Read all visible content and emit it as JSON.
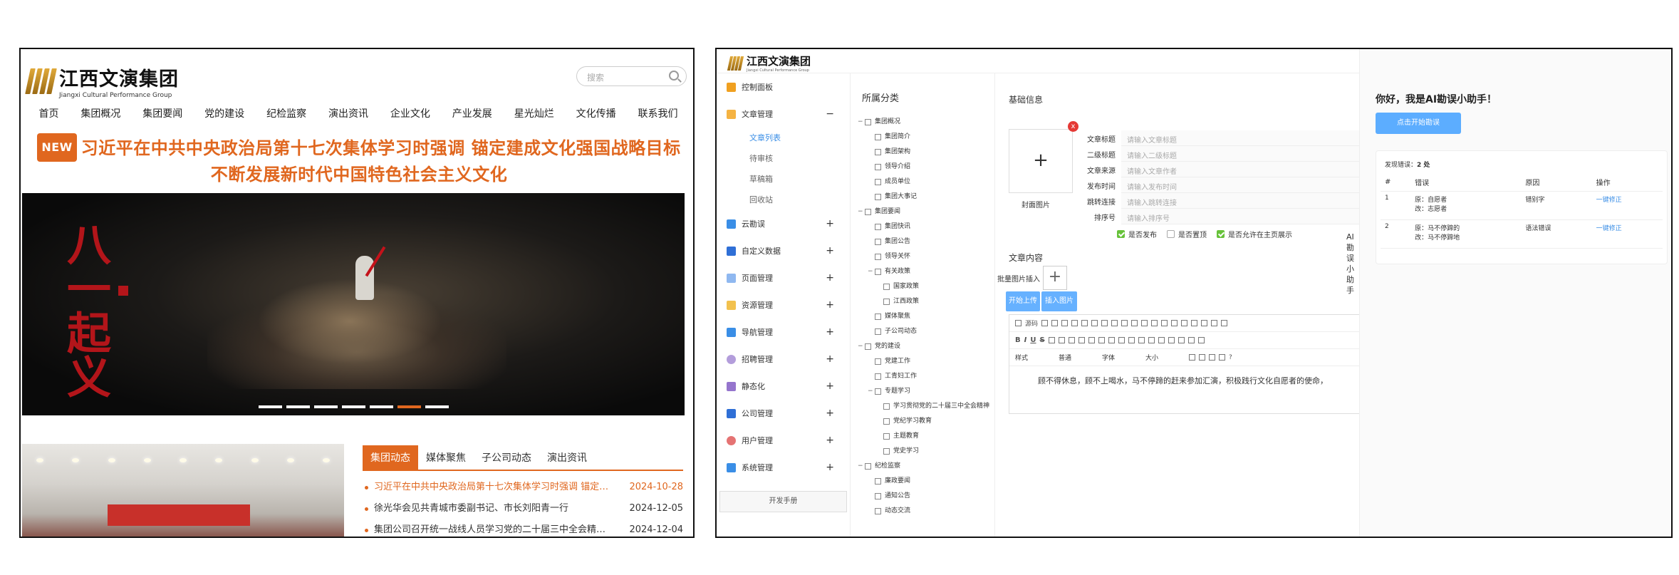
{
  "site": {
    "logo_cn": "江西文演集团",
    "logo_en": "Jiangxi Cultural Performance Group",
    "search_placeholder": "搜索",
    "nav": [
      "首页",
      "集团概况",
      "集团要闻",
      "党的建设",
      "纪检监察",
      "演出资讯",
      "企业文化",
      "产业发展",
      "星光灿烂",
      "文化传播",
      "联系我们"
    ],
    "new_badge": "NEW",
    "headline_line1": "习近平在中共中央政治局第十七次集体学习时强调 锚定建成文化强国战略目标",
    "headline_line2": "不断发展新时代中国特色社会主义文化",
    "banner_callig": "八一起义",
    "tabs": [
      "集团动态",
      "媒体聚焦",
      "子公司动态",
      "演出资讯"
    ],
    "news": [
      {
        "title": "习近平在中共中央政治局第十七次集体学习时强调 锚定建...",
        "date": "2024-10-28"
      },
      {
        "title": "徐光华会见共青城市委副书记、市长刘阳青一行",
        "date": "2024-12-05"
      },
      {
        "title": "集团公司召开统一战线人员学习党的二十届三中全会精神暨...",
        "date": "2024-12-04"
      }
    ]
  },
  "cms": {
    "logo_cn": "江西文演集团",
    "logo_en": "Jiangxi Cultural Performance Group",
    "menu": {
      "dashboard": "控制面板",
      "article_mgmt": "文章管理",
      "article_subs": [
        "文章列表",
        "待审核",
        "草稿箱",
        "回收站"
      ],
      "items": [
        "云勘误",
        "自定义数据",
        "页面管理",
        "资源管理",
        "导航管理",
        "招聘管理",
        "静态化",
        "公司管理",
        "用户管理",
        "系统管理"
      ],
      "dev_manual": "开发手册",
      "minus": "−",
      "plus": "+"
    },
    "category": {
      "title": "所属分类",
      "tree": [
        {
          "label": "集团概况",
          "level": 1,
          "tog": "−"
        },
        {
          "label": "集团简介",
          "level": 2,
          "tog": ""
        },
        {
          "label": "集团架构",
          "level": 2,
          "tog": ""
        },
        {
          "label": "领导介绍",
          "level": 2,
          "tog": ""
        },
        {
          "label": "成员单位",
          "level": 2,
          "tog": ""
        },
        {
          "label": "集团大事记",
          "level": 2,
          "tog": ""
        },
        {
          "label": "集团要闻",
          "level": 1,
          "tog": "−"
        },
        {
          "label": "集团快讯",
          "level": 2,
          "tog": ""
        },
        {
          "label": "集团公告",
          "level": 2,
          "tog": ""
        },
        {
          "label": "领导关怀",
          "level": 2,
          "tog": ""
        },
        {
          "label": "有关政策",
          "level": 2,
          "tog": "−"
        },
        {
          "label": "国家政策",
          "level": 3,
          "tog": ""
        },
        {
          "label": "江西政策",
          "level": 3,
          "tog": ""
        },
        {
          "label": "媒体聚焦",
          "level": 2,
          "tog": ""
        },
        {
          "label": "子公司动态",
          "level": 2,
          "tog": ""
        },
        {
          "label": "党的建设",
          "level": 1,
          "tog": "−"
        },
        {
          "label": "党建工作",
          "level": 2,
          "tog": ""
        },
        {
          "label": "工青妇工作",
          "level": 2,
          "tog": ""
        },
        {
          "label": "专题学习",
          "level": 2,
          "tog": "−"
        },
        {
          "label": "学习贯彻党的二十届三中全会精神",
          "level": 3,
          "tog": ""
        },
        {
          "label": "党纪学习教育",
          "level": 3,
          "tog": ""
        },
        {
          "label": "主题教育",
          "level": 3,
          "tog": ""
        },
        {
          "label": "党史学习",
          "level": 3,
          "tog": ""
        },
        {
          "label": "纪检监察",
          "level": 1,
          "tog": "−"
        },
        {
          "label": "廉政要闻",
          "level": 2,
          "tog": ""
        },
        {
          "label": "通知公告",
          "level": 2,
          "tog": ""
        },
        {
          "label": "动态交流",
          "level": 2,
          "tog": ""
        }
      ]
    },
    "form": {
      "basic_info": "基础信息",
      "cover_plus": "+",
      "cover_x": "x",
      "cover_label": "封面图片",
      "fields": [
        {
          "label": "文章标题",
          "placeholder": "请输入文章标题"
        },
        {
          "label": "二级标题",
          "placeholder": "请输入二级标题"
        },
        {
          "label": "文章来源",
          "placeholder": "请输入文章作者"
        },
        {
          "label": "发布时间",
          "placeholder": "请输入发布时间"
        },
        {
          "label": "跳转连接",
          "placeholder": "请输入跳转连接"
        },
        {
          "label": "排序号",
          "placeholder": "请输入排序号"
        }
      ],
      "checks": [
        {
          "label": "是否发布",
          "checked": true
        },
        {
          "label": "是否置顶",
          "checked": false
        },
        {
          "label": "是否允许在主页展示",
          "checked": true
        }
      ],
      "ai_vertical": "AI勘误小助手",
      "content_title": "文章内容",
      "batch_label": "批量图片插入",
      "batch_plus": "+",
      "btn_upload": "开始上传",
      "btn_insert": "插入图片",
      "toolbar_source": "源码",
      "toolbar_style": "样式",
      "toolbar_normal": "普通",
      "toolbar_font": "字体",
      "toolbar_size": "大小",
      "toolbar_help": "?",
      "editor_text": "顾不得休息，顾不上喝水，马不停蹄的赶来参加汇演，积极践行文化自愿者的使命，"
    },
    "ai": {
      "hello": "你好，我是AI勘误小助手！",
      "start_button": "点击开始勘误",
      "found_prefix": "发现错误：",
      "found_count": "2 处",
      "headers": [
        "#",
        "错误",
        "原因",
        "操作"
      ],
      "rows": [
        {
          "no": "1",
          "orig": "原：自愿者",
          "fixed": "改：志愿者",
          "reason": "错别字",
          "action": "一键修正"
        },
        {
          "no": "2",
          "orig": "原：马不停蹄的",
          "fixed": "改：马不停蹄地",
          "reason": "语法错误",
          "action": "一键修正"
        }
      ]
    }
  },
  "colors": {
    "accent_orange": "#e0671f",
    "cms_blue": "#66b1ff",
    "link_blue": "#3a8ee6"
  }
}
